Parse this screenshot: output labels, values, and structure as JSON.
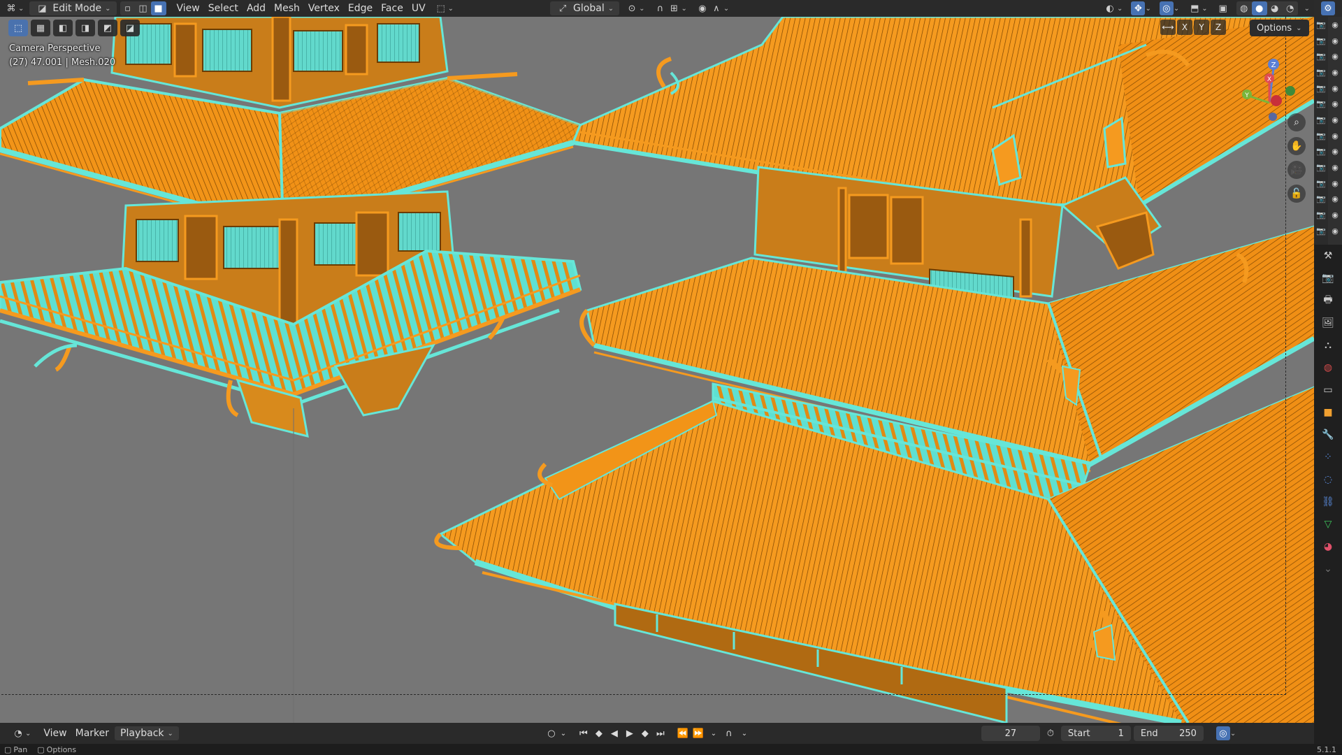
{
  "header": {
    "mode_label": "Edit Mode",
    "menus": [
      "View",
      "Select",
      "Add",
      "Mesh",
      "Vertex",
      "Edge",
      "Face",
      "UV"
    ],
    "transform_orientation": "Global"
  },
  "viewport": {
    "overlay_title": "Camera Perspective",
    "overlay_info": "(27) 47.001 | Mesh.020",
    "axes": [
      "X",
      "Y",
      "Z"
    ],
    "options_label": "Options",
    "gizmo_labels": {
      "z": "Z",
      "x": "X",
      "y": "Y"
    },
    "colors": {
      "background": "#767676",
      "selected_face": "#f59a1f",
      "selected_edge": "#66e6d8",
      "dark_edge": "#6b3c00"
    }
  },
  "timeline": {
    "menus": [
      "View",
      "Marker",
      "Playback"
    ],
    "current_frame": "27",
    "start_label": "Start",
    "start_value": "1",
    "end_label": "End",
    "end_value": "250"
  },
  "statusbar": {
    "left": "Pan",
    "right": "Options",
    "version": "5.1.1"
  }
}
